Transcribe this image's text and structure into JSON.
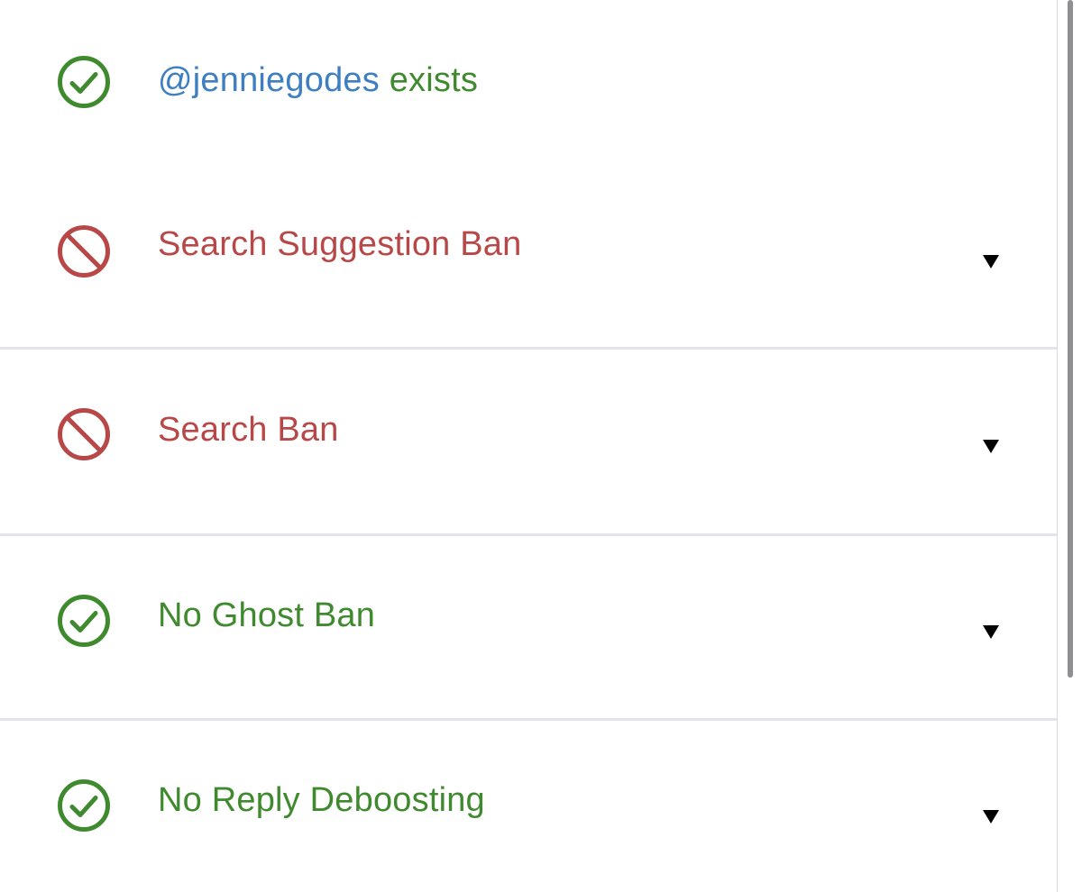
{
  "status": {
    "handle": "@jenniegodes",
    "exists_suffix": " exists",
    "handle_color": "#3d7fc1"
  },
  "checks": [
    {
      "label": "Search Suggestion Ban",
      "result": "banned",
      "icon": "prohibited-icon",
      "color": "#b84848"
    },
    {
      "label": "Search Ban",
      "result": "banned",
      "icon": "prohibited-icon",
      "color": "#b84848"
    },
    {
      "label": "No Ghost Ban",
      "result": "ok",
      "icon": "check-circle-icon",
      "color": "#3f8a2e"
    },
    {
      "label": "No Reply Deboosting",
      "result": "ok",
      "icon": "check-circle-icon",
      "color": "#3f8a2e"
    }
  ],
  "colors": {
    "ok": "#3f8a2e",
    "bad": "#b84848",
    "divider": "#e3e3ec"
  }
}
